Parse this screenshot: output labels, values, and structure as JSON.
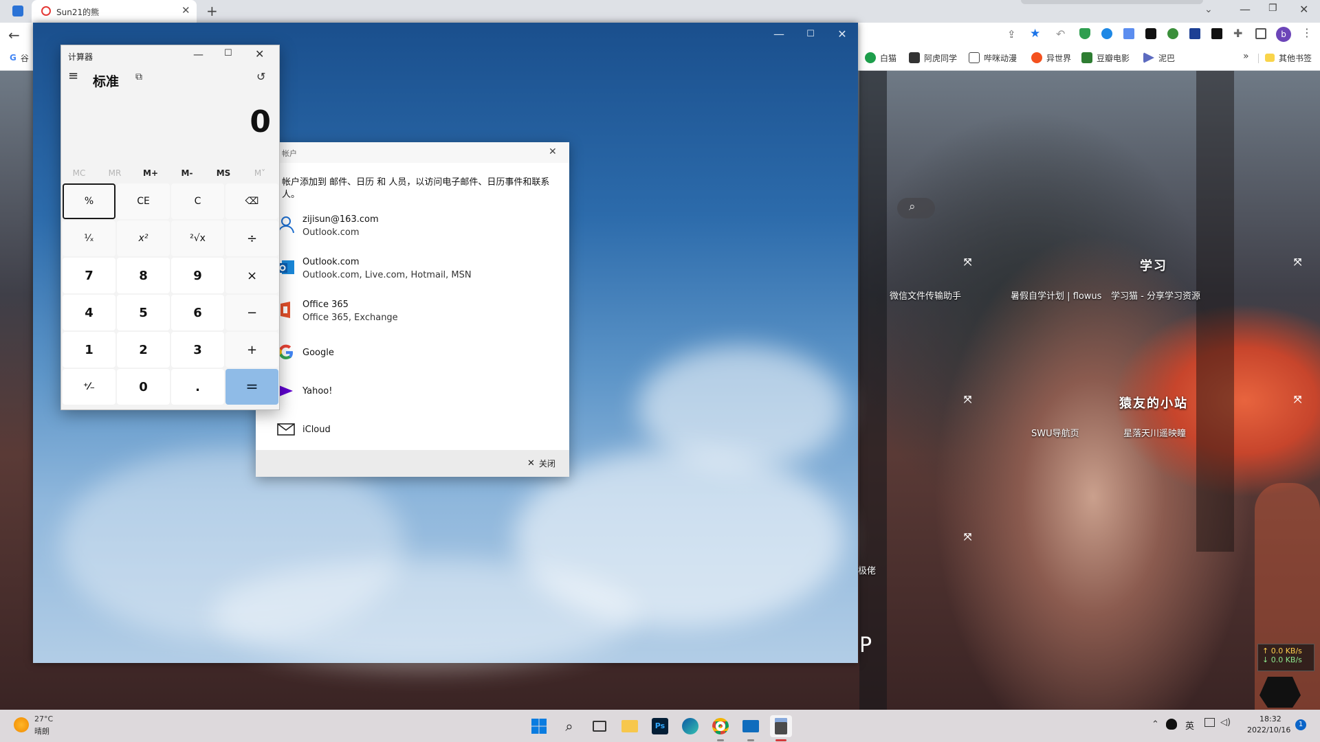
{
  "browser": {
    "tab_title": "Sun21的熊",
    "new_tab": "+",
    "bookmarks": [
      "白猫",
      "阿虎同学",
      "哔咪动漫",
      "异世界",
      "豆瓣电影",
      "泥巴"
    ],
    "bookmarks_overflow": "»",
    "other_bookmarks": "其他书签",
    "profile_initial": "b",
    "bookmark_first_partial": "谷"
  },
  "website": {
    "groups": [
      {
        "title": "学习",
        "links": [
          "微信文件传输助手",
          "暑假自学计划 | flowus",
          "学习猫 - 分享学习资源"
        ]
      },
      {
        "title": "猿友的小站",
        "links": [
          "SWU导航页",
          "星落天川遥映瞳"
        ]
      }
    ],
    "partial_left_text": "极佬",
    "left_edge_letter": "P",
    "net_speed": {
      "up": "↑ 0.0 KB/s",
      "down": "↓ 0.0 KB/s"
    }
  },
  "calculator": {
    "title": "计算器",
    "mode": "标准",
    "display": "0",
    "memory": [
      "MC",
      "MR",
      "M+",
      "M-",
      "MS",
      "M˅"
    ],
    "keys": [
      [
        "%",
        "CE",
        "C",
        "⌫"
      ],
      [
        "¹⁄ₓ",
        "x²",
        "²√x",
        "÷"
      ],
      [
        "7",
        "8",
        "9",
        "×"
      ],
      [
        "4",
        "5",
        "6",
        "−"
      ],
      [
        "1",
        "2",
        "3",
        "+"
      ],
      [
        "⁺⁄₋",
        "0",
        ".",
        "="
      ]
    ]
  },
  "accounts_dialog": {
    "title": "帐户",
    "description": "帐户添加到 邮件、日历 和 人员，以访问电子邮件、日历事件和联系人。",
    "accounts": [
      {
        "name": "zijisun@163.com",
        "detail": "Outlook.com",
        "icon": "person-icon"
      },
      {
        "name": "Outlook.com",
        "detail": "Outlook.com, Live.com, Hotmail, MSN",
        "icon": "outlook-icon"
      },
      {
        "name": "Office 365",
        "detail": "Office 365, Exchange",
        "icon": "office-icon"
      },
      {
        "name": "Google",
        "detail": "",
        "icon": "google-icon"
      },
      {
        "name": "Yahoo!",
        "detail": "",
        "icon": "yahoo-icon"
      },
      {
        "name": "iCloud",
        "detail": "",
        "icon": "mail-icon"
      }
    ],
    "close_label": "关闭"
  },
  "taskbar": {
    "weather_temp": "27°C",
    "weather_desc": "晴朗",
    "ime": "英",
    "time": "18:32",
    "date": "2022/10/16",
    "notification_count": "1"
  },
  "colors": {
    "accent_equals": "#8fbbe7",
    "mail_bg_top": "#1a4f8d",
    "browser_frame": "#dee1e6"
  }
}
